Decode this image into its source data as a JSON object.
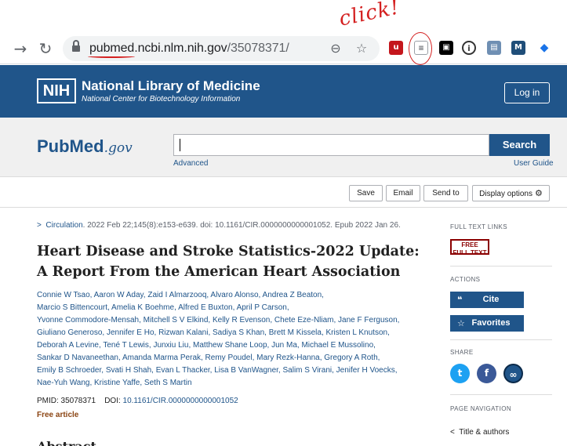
{
  "browser": {
    "url_host": "pubmed.ncbi.nlm.nih.gov",
    "url_path": "/35078371/",
    "annotation": "click!"
  },
  "header": {
    "logo": "NIH",
    "title": "National Library of Medicine",
    "subtitle": "National Center for Biotechnology Information",
    "login": "Log in"
  },
  "search": {
    "logo_main": "PubMed",
    "logo_suffix": ".gov",
    "button": "Search",
    "advanced": "Advanced",
    "user_guide": "User Guide"
  },
  "actions": {
    "save": "Save",
    "email": "Email",
    "send_to": "Send to",
    "display_options": "Display options"
  },
  "article": {
    "journal": "Circulation",
    "citation_rest": ". 2022 Feb 22;145(8):e153-e639. doi: 10.1161/CIR.0000000000001052. Epub 2022 Jan 26.",
    "title": "Heart Disease and Stroke Statistics-2022 Update: A Report From the American Heart Association",
    "authors": [
      "Connie W Tsao, Aaron W Aday, Zaid I Almarzooq, Alvaro Alonso, Andrea Z Beaton,",
      "Marcio S Bittencourt, Amelia K Boehme, Alfred E Buxton, April P Carson,",
      "Yvonne Commodore-Mensah, Mitchell S V Elkind, Kelly R Evenson, Chete Eze-Nliam, Jane F Ferguson,",
      "Giuliano Generoso, Jennifer E Ho, Rizwan Kalani, Sadiya S Khan, Brett M Kissela, Kristen L Knutson,",
      "Deborah A Levine, Tené T Lewis, Junxiu Liu, Matthew Shane Loop, Jun Ma, Michael E Mussolino,",
      "Sankar D Navaneethan, Amanda Marma Perak, Remy Poudel, Mary Rezk-Hanna, Gregory A Roth,",
      "Emily B Schroeder, Svati H Shah, Evan L Thacker, Lisa B VanWagner, Salim S Virani, Jenifer H Voecks,",
      "Nae-Yuh Wang, Kristine Yaffe, Seth S Martin"
    ],
    "pmid_label": "PMID: 35078371",
    "doi_label": "DOI:",
    "doi_value": "10.1161/CIR.0000000000001052",
    "free_article": "Free article",
    "abstract_heading": "Abstract"
  },
  "sidebar": {
    "full_text_links": "FULL TEXT LINKS",
    "free_full_text_line1": "FREE",
    "free_full_text_line2": "FULL TEXT",
    "actions_heading": "ACTIONS",
    "cite": "Cite",
    "favorites": "Favorites",
    "share_heading": "SHARE",
    "page_nav_heading": "PAGE NAVIGATION",
    "title_authors": "Title & authors"
  },
  "colors": {
    "brand_blue": "#20558a",
    "annotation_red": "#d42020"
  }
}
